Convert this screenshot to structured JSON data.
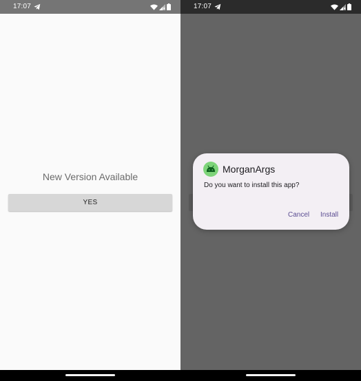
{
  "status_bar": {
    "time": "17:07"
  },
  "left_screen": {
    "title": "New Version Available",
    "yes_button": "YES"
  },
  "install_dialog": {
    "app_name": "MorganArgs",
    "message": "Do you want to install this app?",
    "cancel_button": "Cancel",
    "install_button": "Install"
  },
  "colors": {
    "accent_button_text": "#5b4d92",
    "app_icon_bg": "#7ed47a",
    "dialog_bg": "#f3eff4",
    "scrim": "#646464"
  },
  "icons": [
    "send-icon",
    "wifi-icon",
    "signal-icon",
    "battery-icon",
    "android-icon"
  ]
}
